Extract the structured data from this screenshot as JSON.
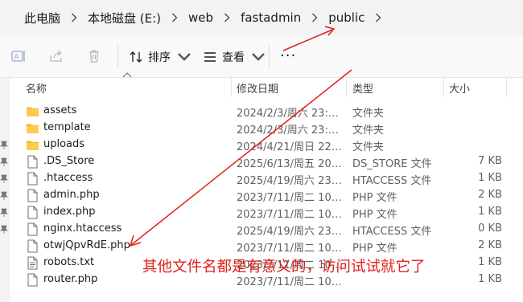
{
  "breadcrumb": {
    "items": [
      "此电脑",
      "本地磁盘 (E:)",
      "web",
      "fastadmin",
      "public"
    ]
  },
  "toolbar": {
    "sort_label": "排序",
    "view_label": "查看",
    "more_label": "···"
  },
  "columns": {
    "name": "名称",
    "date": "修改日期",
    "type": "类型",
    "size": "大小"
  },
  "files": [
    {
      "name": "assets",
      "date": "2024/2/3/周六 23:…",
      "type": "文件夹",
      "size": "",
      "icon": "folder-icon"
    },
    {
      "name": "template",
      "date": "2024/2/3/周六 23:…",
      "type": "文件夹",
      "size": "",
      "icon": "folder-icon"
    },
    {
      "name": "uploads",
      "date": "2024/4/21/周日 22…",
      "type": "文件夹",
      "size": "",
      "icon": "folder-icon"
    },
    {
      "name": ".DS_Store",
      "date": "2025/6/13/周五 20…",
      "type": "DS_STORE 文件",
      "size": "7 KB",
      "icon": "file-icon"
    },
    {
      "name": ".htaccess",
      "date": "2025/4/19/周六 23…",
      "type": "HTACCESS 文件",
      "size": "1 KB",
      "icon": "file-icon"
    },
    {
      "name": "admin.php",
      "date": "2023/7/11/周二 10…",
      "type": "PHP 文件",
      "size": "2 KB",
      "icon": "file-icon"
    },
    {
      "name": "index.php",
      "date": "2023/7/11/周二 10…",
      "type": "PHP 文件",
      "size": "1 KB",
      "icon": "file-icon"
    },
    {
      "name": "nginx.htaccess",
      "date": "2025/4/19/周六 23…",
      "type": "HTACCESS 文件",
      "size": "0 KB",
      "icon": "file-icon"
    },
    {
      "name": "otwjQpvRdE.php",
      "date": "2023/7/11/周二 10…",
      "type": "PHP 文件",
      "size": "2 KB",
      "icon": "file-icon"
    },
    {
      "name": "robots.txt",
      "date": "2023/7/11/周二 10…",
      "type": "",
      "size": "1 KB",
      "icon": "text-file-icon"
    },
    {
      "name": "router.php",
      "date": "2023/7/11/周二 10…",
      "type": "",
      "size": "1 KB",
      "icon": "file-icon"
    }
  ],
  "annotation": {
    "text": "其他文件名都是有意义的，访问试试就它了",
    "color": "#e0211b"
  }
}
